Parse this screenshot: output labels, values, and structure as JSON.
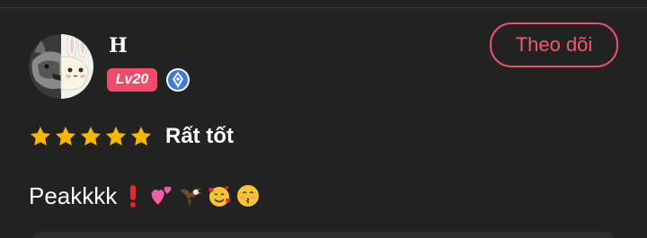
{
  "user": {
    "name": "H",
    "level": "Lv20"
  },
  "follow": {
    "label": "Theo dõi"
  },
  "rating": {
    "value": 5,
    "max": 5,
    "label": "Rất tốt"
  },
  "comment": {
    "text": "Peakkkk",
    "emojis": [
      "red-exclamation-icon",
      "two-hearts-icon",
      "eagle-icon",
      "smiling-face-with-hearts-icon",
      "kissing-face-icon"
    ]
  },
  "colors": {
    "background": "#222222",
    "accent": "#ef5a72",
    "level_badge": "#f04c6a",
    "star": "#f5b800",
    "verify": "#3a7be0"
  }
}
